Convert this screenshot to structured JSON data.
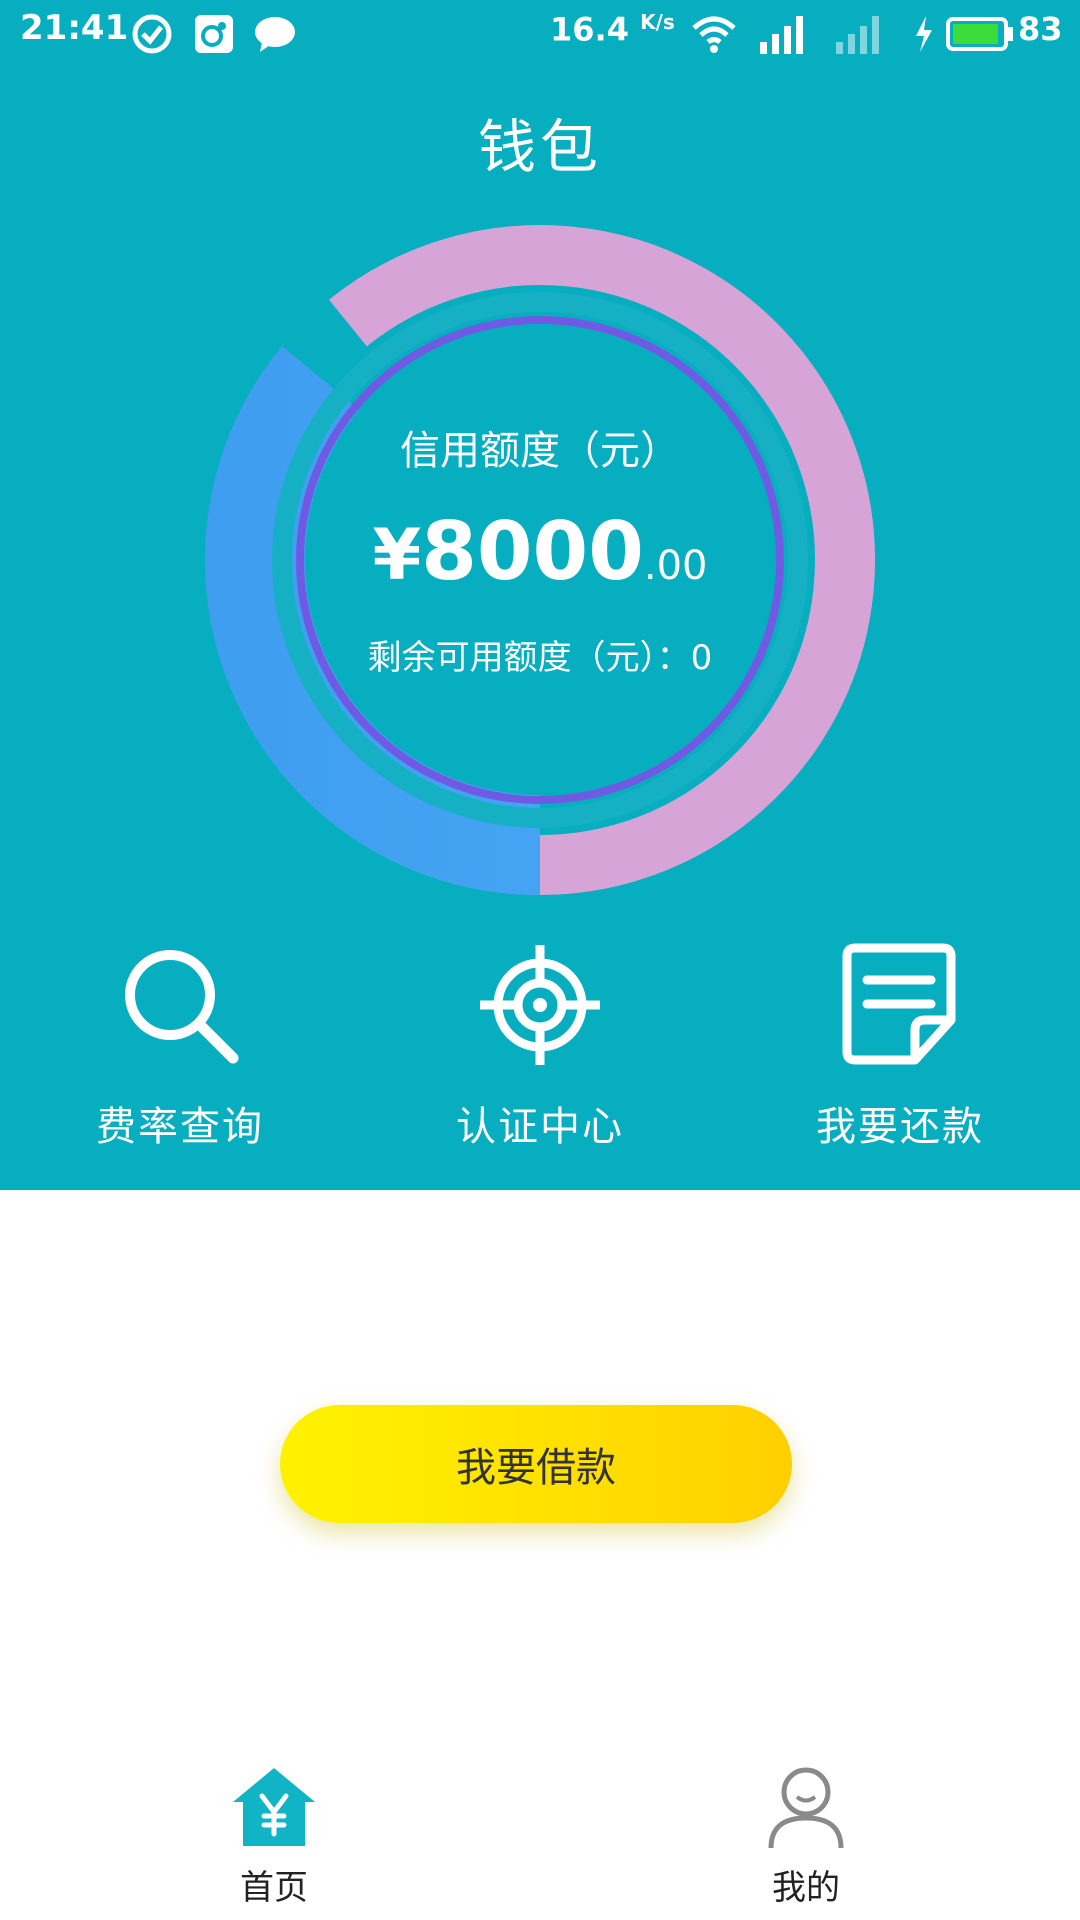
{
  "status_bar": {
    "time": "21:41",
    "net_speed": "16.4",
    "net_speed_unit": "K/s",
    "battery_level": "83",
    "icons": [
      "check-circle-icon",
      "app-icon",
      "chat-icon",
      "wifi-icon",
      "signal-4g-icon",
      "signal-icon",
      "charging-icon",
      "battery-icon"
    ]
  },
  "header": {
    "title": "钱包"
  },
  "credit": {
    "label": "信用额度（元）",
    "currency": "¥",
    "amount_main": "8000",
    "amount_decimal": ".00",
    "remaining_label": "剩余可用额度（元）：",
    "remaining_value": "0"
  },
  "actions": [
    {
      "label": "费率查询",
      "icon": "search-icon"
    },
    {
      "label": "认证中心",
      "icon": "target-icon"
    },
    {
      "label": "我要还款",
      "icon": "document-icon"
    }
  ],
  "borrow_button": {
    "label": "我要借款"
  },
  "bottom_nav": [
    {
      "label": "首页",
      "icon": "home-yen-icon",
      "active": true
    },
    {
      "label": "我的",
      "icon": "user-icon",
      "active": false
    }
  ],
  "colors": {
    "header_bg": "#07aec0",
    "ring_blue": "#43a4f3",
    "ring_pink": "#d7a4d8",
    "ring_inner": "#6f5be3",
    "button_yellow": "#ffe200",
    "nav_active": "#10b4c4"
  }
}
